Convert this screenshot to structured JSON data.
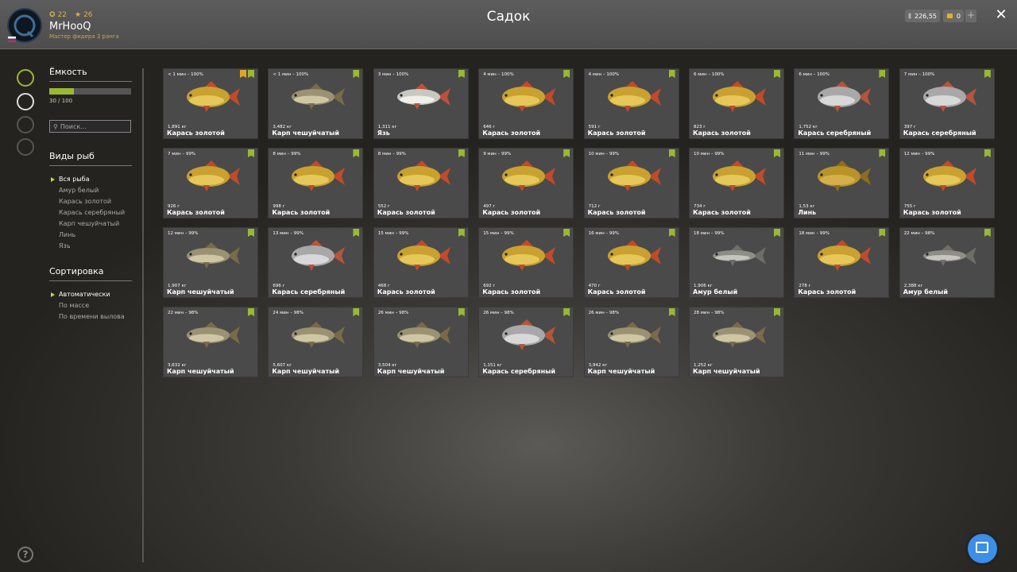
{
  "header": {
    "title": "Садок",
    "user": {
      "name": "MrHooQ",
      "rank": "Мастер фидера 3 ранга",
      "level": "22",
      "stars": "26"
    },
    "silver": "226,55",
    "gold": "0"
  },
  "sidebar": {
    "capacity": {
      "title": "Ёмкость",
      "value": "30 / 100",
      "fraction": 0.3
    },
    "search_placeholder": "Поиск...",
    "fish_types": {
      "title": "Виды рыб",
      "items": [
        "Вся рыба",
        "Амур белый",
        "Карась золотой",
        "Карась серебряный",
        "Карп чешуйчатый",
        "Линь",
        "Язь"
      ],
      "selected": 0
    },
    "sort": {
      "title": "Сортировка",
      "items": [
        "Автоматически",
        "По массе",
        "По времени вылова"
      ],
      "selected": 0
    }
  },
  "fish": [
    {
      "time": "< 1 мин – 100%",
      "weight": "1,891 кг",
      "name": "Карась золотой",
      "kind": "gold",
      "star": true
    },
    {
      "time": "< 1 мин – 100%",
      "weight": "3,482 кг",
      "name": "Карп чешуйчатый",
      "kind": "carp"
    },
    {
      "time": "3 мин – 100%",
      "weight": "1,311 кг",
      "name": "Язь",
      "kind": "ide"
    },
    {
      "time": "4 мин – 100%",
      "weight": "646 г",
      "name": "Карась золотой",
      "kind": "gold"
    },
    {
      "time": "4 мин – 100%",
      "weight": "591 г",
      "name": "Карась золотой",
      "kind": "gold"
    },
    {
      "time": "6 мин – 100%",
      "weight": "823 г",
      "name": "Карась золотой",
      "kind": "gold"
    },
    {
      "time": "6 мин – 100%",
      "weight": "1,752 кг",
      "name": "Карась серебряный",
      "kind": "silver"
    },
    {
      "time": "7 мин – 100%",
      "weight": "397 г",
      "name": "Карась серебряный",
      "kind": "silver"
    },
    {
      "time": "7 мин – 99%",
      "weight": "926 г",
      "name": "Карась золотой",
      "kind": "gold"
    },
    {
      "time": "8 мин – 99%",
      "weight": "998 г",
      "name": "Карась золотой",
      "kind": "gold"
    },
    {
      "time": "8 мин – 99%",
      "weight": "552 г",
      "name": "Карась золотой",
      "kind": "gold"
    },
    {
      "time": "9 мин – 99%",
      "weight": "497 г",
      "name": "Карась золотой",
      "kind": "gold"
    },
    {
      "time": "10 мин – 99%",
      "weight": "712 г",
      "name": "Карась золотой",
      "kind": "gold"
    },
    {
      "time": "10 мин – 99%",
      "weight": "734 г",
      "name": "Карась золотой",
      "kind": "gold"
    },
    {
      "time": "11 мин – 99%",
      "weight": "1,53 кг",
      "name": "Линь",
      "kind": "tench"
    },
    {
      "time": "12 мин – 99%",
      "weight": "755 г",
      "name": "Карась золотой",
      "kind": "gold"
    },
    {
      "time": "12 мин – 99%",
      "weight": "1,907 кг",
      "name": "Карп чешуйчатый",
      "kind": "carp"
    },
    {
      "time": "13 мин – 99%",
      "weight": "696 г",
      "name": "Карась серебряный",
      "kind": "silver"
    },
    {
      "time": "15 мин – 99%",
      "weight": "468 г",
      "name": "Карась золотой",
      "kind": "gold"
    },
    {
      "time": "15 мин – 99%",
      "weight": "692 г",
      "name": "Карась золотой",
      "kind": "gold"
    },
    {
      "time": "16 мин – 99%",
      "weight": "470 г",
      "name": "Карась золотой",
      "kind": "gold"
    },
    {
      "time": "18 мин – 99%",
      "weight": "1,906 кг",
      "name": "Амур белый",
      "kind": "amur"
    },
    {
      "time": "18 мин – 99%",
      "weight": "278 г",
      "name": "Карась золотой",
      "kind": "gold"
    },
    {
      "time": "22 мин – 98%",
      "weight": "2,388 кг",
      "name": "Амур белый",
      "kind": "amur"
    },
    {
      "time": "22 мин – 98%",
      "weight": "3,632 кг",
      "name": "Карп чешуйчатый",
      "kind": "carp"
    },
    {
      "time": "24 мин – 98%",
      "weight": "5,607 кг",
      "name": "Карп чешуйчатый",
      "kind": "carp"
    },
    {
      "time": "26 мин – 98%",
      "weight": "3,504 кг",
      "name": "Карп чешуйчатый",
      "kind": "carp"
    },
    {
      "time": "26 мин – 98%",
      "weight": "1,151 кг",
      "name": "Карась серебряный",
      "kind": "silver"
    },
    {
      "time": "26 мин – 98%",
      "weight": "3,942 кг",
      "name": "Карп чешуйчатый",
      "kind": "carp"
    },
    {
      "time": "28 мин – 98%",
      "weight": "1,252 кг",
      "name": "Карп чешуйчатый",
      "kind": "carp"
    }
  ],
  "colors": {
    "accent": "#9ab832",
    "star": "#e2a427",
    "fab": "#3c8ee6"
  },
  "icons": {
    "rail": [
      "fish-icon",
      "keepnet-icon",
      "rod-icon",
      "home-icon"
    ],
    "help": "help-icon",
    "fab": "cursor-icon"
  }
}
